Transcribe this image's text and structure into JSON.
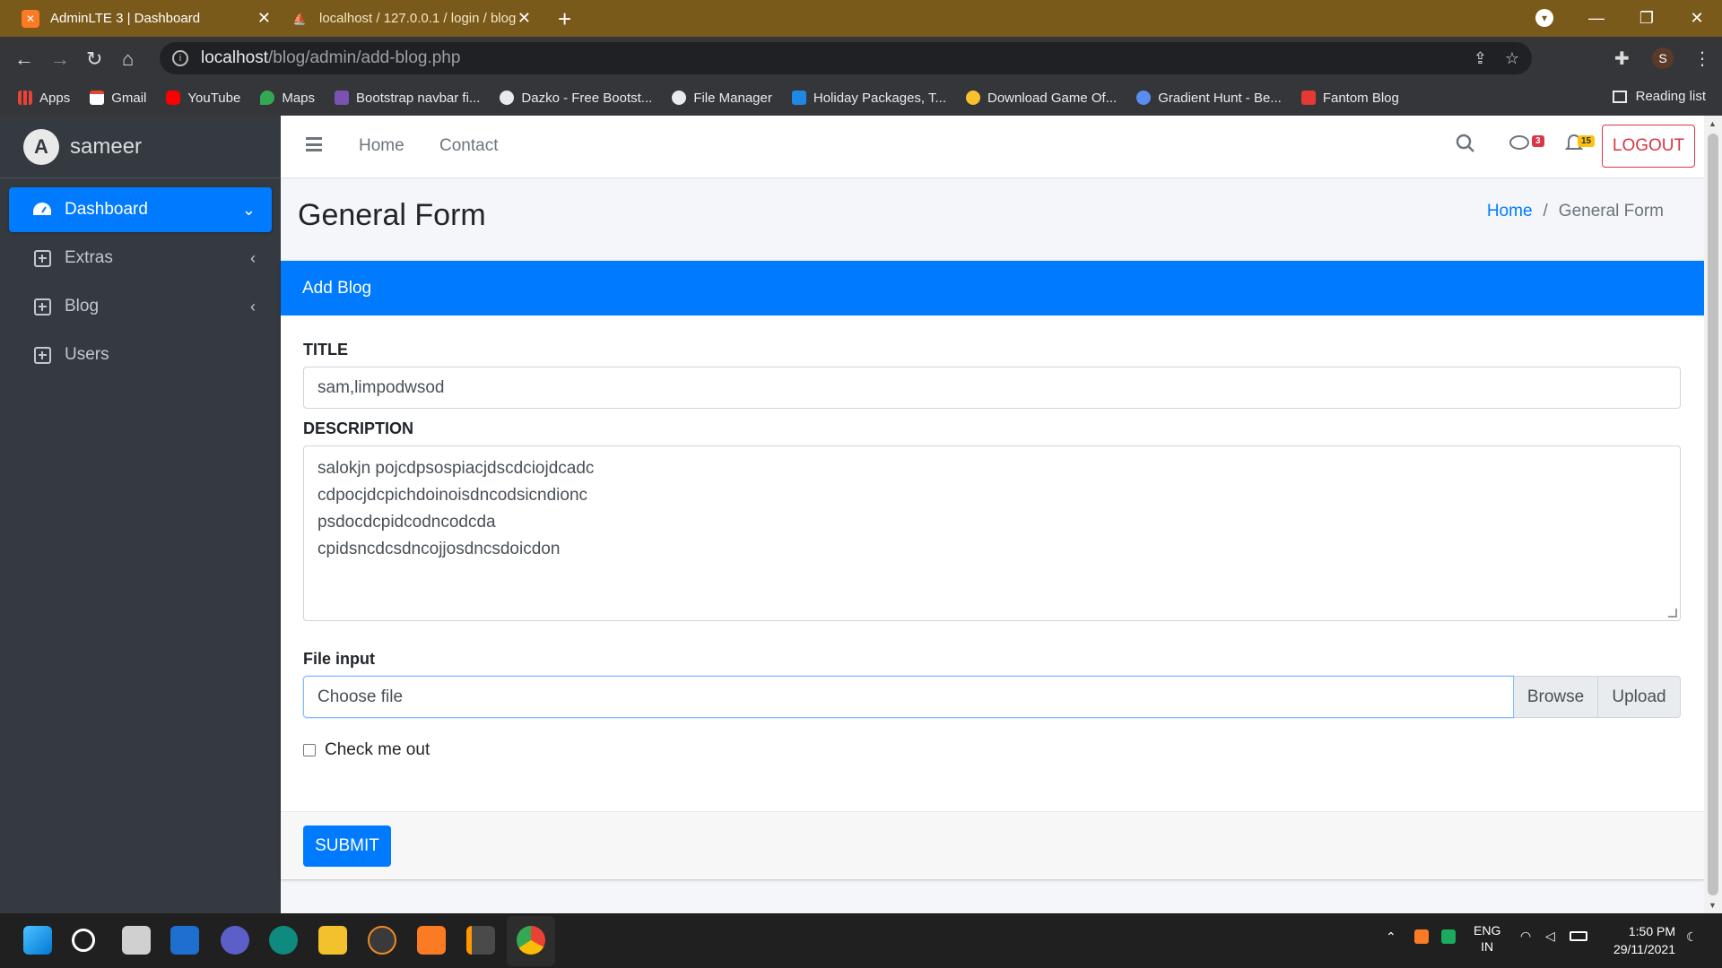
{
  "browser": {
    "tabs": [
      {
        "title": "AdminLTE 3 | Dashboard",
        "active": true,
        "icon": "xampp-icon"
      },
      {
        "title": "localhost / 127.0.0.1 / login / blog",
        "active": false,
        "icon": "phpmyadmin-icon"
      }
    ],
    "url_host": "localhost",
    "url_path": "/blog/admin/add-blog.php",
    "profile_initial": "S",
    "bookmarks": [
      {
        "label": "Apps",
        "icon": "apps-grid-icon",
        "color": "#ea4335"
      },
      {
        "label": "Gmail",
        "icon": "gmail-icon",
        "color": "#ea4335"
      },
      {
        "label": "YouTube",
        "icon": "youtube-icon",
        "color": "#ff0000"
      },
      {
        "label": "Maps",
        "icon": "maps-icon",
        "color": "#34a853"
      },
      {
        "label": "Bootstrap navbar fi...",
        "icon": "bootstrap-icon",
        "color": "#7952b3"
      },
      {
        "label": "Dazko - Free Bootst...",
        "icon": "globe-icon",
        "color": "#e8eaed"
      },
      {
        "label": "File Manager",
        "icon": "globe-icon",
        "color": "#e8eaed"
      },
      {
        "label": "Holiday Packages, T...",
        "icon": "plane-icon",
        "color": "#1e88e5"
      },
      {
        "label": "Download Game Of...",
        "icon": "v-icon",
        "color": "#fbc02d"
      },
      {
        "label": "Gradient Hunt - Be...",
        "icon": "gradient-icon",
        "color": "#5b8def"
      },
      {
        "label": "Fantom Blog",
        "icon": "fantom-icon",
        "color": "#e53935"
      }
    ],
    "reading_list": "Reading list"
  },
  "sidebar": {
    "brand": "sameer",
    "items": [
      {
        "label": "Dashboard",
        "icon": "tachometer-icon",
        "active": true
      },
      {
        "label": "Extras",
        "icon": "plus-square-icon",
        "active": false
      },
      {
        "label": "Blog",
        "icon": "plus-square-icon",
        "active": false
      },
      {
        "label": "Users",
        "icon": "plus-square-icon",
        "active": false
      }
    ]
  },
  "topnav": {
    "home": "Home",
    "contact": "Contact",
    "messages_count": "3",
    "notifications_count": "15",
    "logout": "LOGOUT"
  },
  "header": {
    "title": "General Form",
    "breadcrumb_home": "Home",
    "breadcrumb_current": "General Form"
  },
  "form": {
    "card_title": "Add Blog",
    "title_label": "TITLE",
    "title_value": "sam,limpodwsod",
    "description_label": "DESCRIPTION",
    "description_lines": [
      "salokjn pojcdpsospiacjdscdciojdcadc",
      "cdpocjdcpichdoinoisdncodsicndionc",
      "psdocdcpidcodncodcda",
      "cpidsncdcsdncojjosdncsdoicdon"
    ],
    "file_label": "File input",
    "file_placeholder": "Choose file",
    "browse": "Browse",
    "upload": "Upload",
    "check_label": "Check me out",
    "submit": "SUBMIT"
  },
  "taskbar": {
    "lang1": "ENG",
    "lang2": "IN",
    "time": "1:50 PM",
    "date": "29/11/2021"
  },
  "colors": {
    "primary": "#007bff",
    "sidebar_bg": "#343a40",
    "danger": "#dc3545",
    "tab_bar": "#7a5a1a"
  }
}
